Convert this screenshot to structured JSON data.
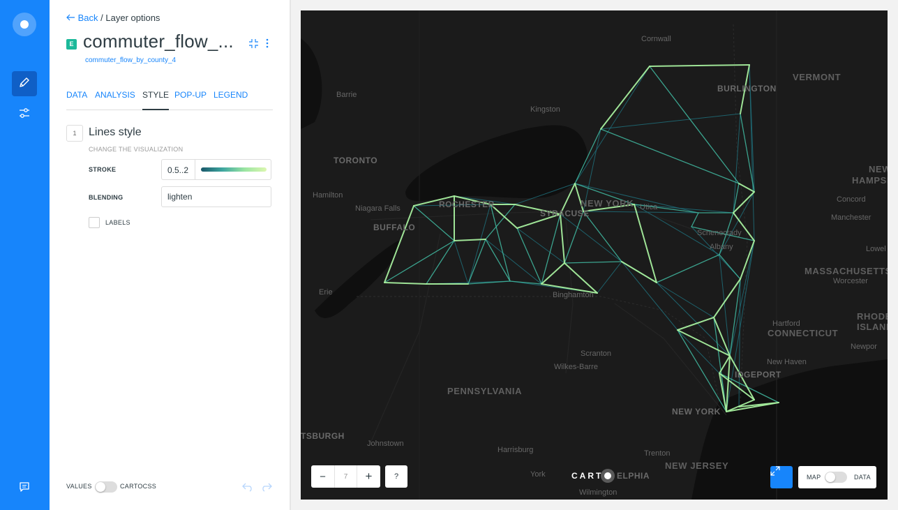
{
  "sidebar": {
    "icons": [
      "carto-logo-icon",
      "pencil-icon",
      "sliders-icon",
      "chat-icon"
    ]
  },
  "panel": {
    "back_label": "Back",
    "breadcrumb": "/ Layer options",
    "layer_badge": "E",
    "layer_title": "commuter_flow_...",
    "layer_subtitle": "commuter_flow_by_county_4",
    "tabs": [
      {
        "label": "DATA",
        "active": false
      },
      {
        "label": "ANALYSIS",
        "active": false
      },
      {
        "label": "STYLE",
        "active": true
      },
      {
        "label": "POP-UP",
        "active": false
      },
      {
        "label": "LEGEND",
        "active": false
      }
    ],
    "section": {
      "number": "1",
      "title": "Lines style",
      "subtitle": "CHANGE THE VISUALIZATION"
    },
    "stroke": {
      "label": "STROKE",
      "value": "0.5..2",
      "ramp_colors": [
        "#19586a",
        "#3fa7a0",
        "#9be5a2",
        "#dcf7b0"
      ]
    },
    "blending": {
      "label": "BLENDING",
      "value": "lighten"
    },
    "labels_checkbox": {
      "label": "LABELS",
      "checked": false
    },
    "footer": {
      "values_label": "VALUES",
      "cartocss_label": "CARTOCSS",
      "toggle_on": false
    }
  },
  "map": {
    "labels": {
      "cornwall": "Cornwall",
      "vermont": "VERMONT",
      "barrie": "Barrie",
      "burlington": "BURLINGTON",
      "kingston": "Kingston",
      "toronto": "TORONTO",
      "new_hampshire_1": "NEW",
      "new_hampshire_2": "HAMPSHIR",
      "hamilton": "Hamilton",
      "niagara": "Niagara Falls",
      "rochester": "ROCHESTER",
      "syracuse": "SYRACUSE",
      "new_york_state": "NEW YORK",
      "utica": "Utica",
      "concord": "Concord",
      "buffalo": "BUFFALO",
      "schenectady": "Schenectady",
      "albany": "Albany",
      "manchester": "Manchester",
      "lowell": "Lowel",
      "massachusetts": "MASSACHUSETTS",
      "worcester": "Worcester",
      "erie": "Erie",
      "binghamton": "Binghamton",
      "hartford": "Hartford",
      "rhode_1": "RHODE",
      "rhode_2": "ISLAND",
      "connecticut": "CONNECTICUT",
      "newport": "Newpor",
      "scranton": "Scranton",
      "wilkes_barre": "Wilkes-Barre",
      "new_haven": "New Haven",
      "bridgeport": "IDGEPORT",
      "pennsylvania": "PENNSYLVANIA",
      "new_york_city": "NEW YORK",
      "pittsburgh": "TSBURGH",
      "johnstown": "Johnstown",
      "harrisburg": "Harrisburg",
      "trenton": "Trenton",
      "new_jersey": "NEW JERSEY",
      "york": "York",
      "philadelphia": "ELPHIA",
      "wilmington": "Wilmington"
    },
    "zoom_out": "−",
    "zoom_level": "7",
    "zoom_in": "+",
    "help": "?",
    "attribution_logo": "CARTO",
    "view_toggle": {
      "map_label": "MAP",
      "data_label": "DATA",
      "data_on": false
    },
    "flow_colors": {
      "weak": "#1f6f7a",
      "mid": "#3fb39b",
      "strong": "#a7ef9e"
    }
  }
}
